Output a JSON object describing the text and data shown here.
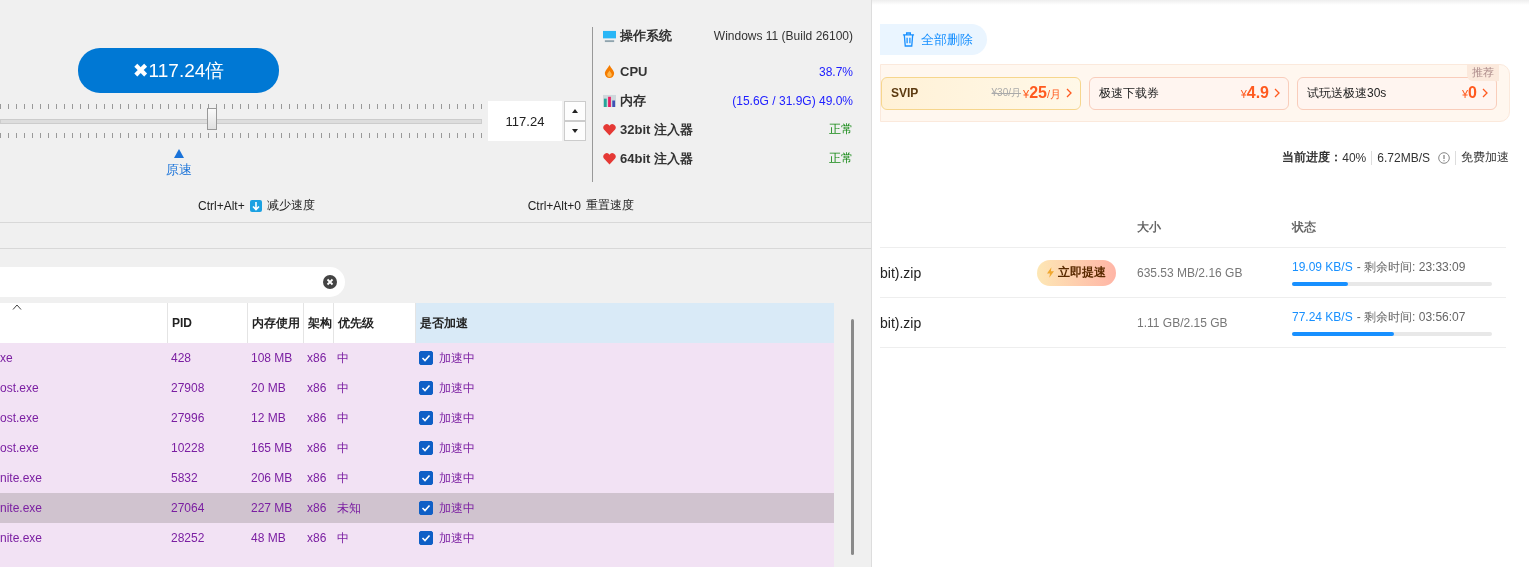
{
  "speed_panel": {
    "speed_badge": "✖117.24倍",
    "slider": {
      "level": 0.44
    },
    "spin_value": "117.24",
    "origin_label": "原速",
    "shortcuts": [
      {
        "keys": "Ctrl+Alt+",
        "arrow": true,
        "action": "减少速度"
      },
      {
        "keys": "Ctrl+Alt+0",
        "arrow": false,
        "action": "重置速度"
      }
    ]
  },
  "system_info": [
    {
      "kind": "os",
      "label": "操作系统",
      "value": "Windows 11 (Build 26100)"
    },
    {
      "kind": "cpu",
      "label": "CPU",
      "value": "38.7%"
    },
    {
      "kind": "memory",
      "label": "内存",
      "value": "(15.6G / 31.9G) 49.0%"
    },
    {
      "kind": "injector",
      "label": "32bit 注入器",
      "value": "正常"
    },
    {
      "kind": "injector",
      "label": "64bit 注入器",
      "value": "正常"
    }
  ],
  "process_table": {
    "columns": [
      "PID",
      "内存使用",
      "架构",
      "优先级",
      "是否加速"
    ],
    "rows": [
      {
        "name": "xe",
        "pid": "428",
        "memory": "108 MB",
        "arch": "x86",
        "priority": "中",
        "accelerated": true,
        "status": "加速中",
        "selected": false
      },
      {
        "name": "ost.exe",
        "pid": "27908",
        "memory": "20 MB",
        "arch": "x86",
        "priority": "中",
        "accelerated": true,
        "status": "加速中",
        "selected": false
      },
      {
        "name": "ost.exe",
        "pid": "27996",
        "memory": "12 MB",
        "arch": "x86",
        "priority": "中",
        "accelerated": true,
        "status": "加速中",
        "selected": false
      },
      {
        "name": "ost.exe",
        "pid": "10228",
        "memory": "165 MB",
        "arch": "x86",
        "priority": "中",
        "accelerated": true,
        "status": "加速中",
        "selected": false
      },
      {
        "name": "nite.exe",
        "pid": "5832",
        "memory": "206 MB",
        "arch": "x86",
        "priority": "中",
        "accelerated": true,
        "status": "加速中",
        "selected": false
      },
      {
        "name": "nite.exe",
        "pid": "27064",
        "memory": "227 MB",
        "arch": "x86",
        "priority": "未知",
        "accelerated": true,
        "status": "加速中",
        "selected": true
      },
      {
        "name": "nite.exe",
        "pid": "28252",
        "memory": "48 MB",
        "arch": "x86",
        "priority": "中",
        "accelerated": true,
        "status": "加速中",
        "selected": false
      }
    ]
  },
  "download_page": {
    "delete_all": "全部删除",
    "promo": {
      "tag": "推荐",
      "offers": [
        {
          "kind": "svip",
          "name": "SVIP",
          "old_price": "¥30/月",
          "currency": "¥",
          "price": "25",
          "unit": "/月"
        },
        {
          "kind": "plain",
          "name": "极速下载券",
          "currency": "¥",
          "price": "4.9"
        },
        {
          "kind": "plain",
          "name": "试玩送极速30s",
          "currency": "¥",
          "price": "0"
        }
      ]
    },
    "progress": {
      "label": "当前进度：",
      "percent": "40%",
      "speed": "6.72MB/S",
      "boost": "免费加速"
    },
    "columns": [
      "大小",
      "状态"
    ],
    "rows": [
      {
        "name": "bit).zip",
        "boost": "立即提速",
        "size": "635.53 MB/2.16 GB",
        "speed": "19.09 KB/S",
        "remaining": "- 剩余时间: 23:33:09",
        "level": 0.28
      },
      {
        "name": "bit).zip",
        "size": "1.11 GB/2.15 GB",
        "speed": "77.24 KB/S",
        "remaining": "- 剩余时间: 03:56:07",
        "level": 0.51
      }
    ]
  }
}
